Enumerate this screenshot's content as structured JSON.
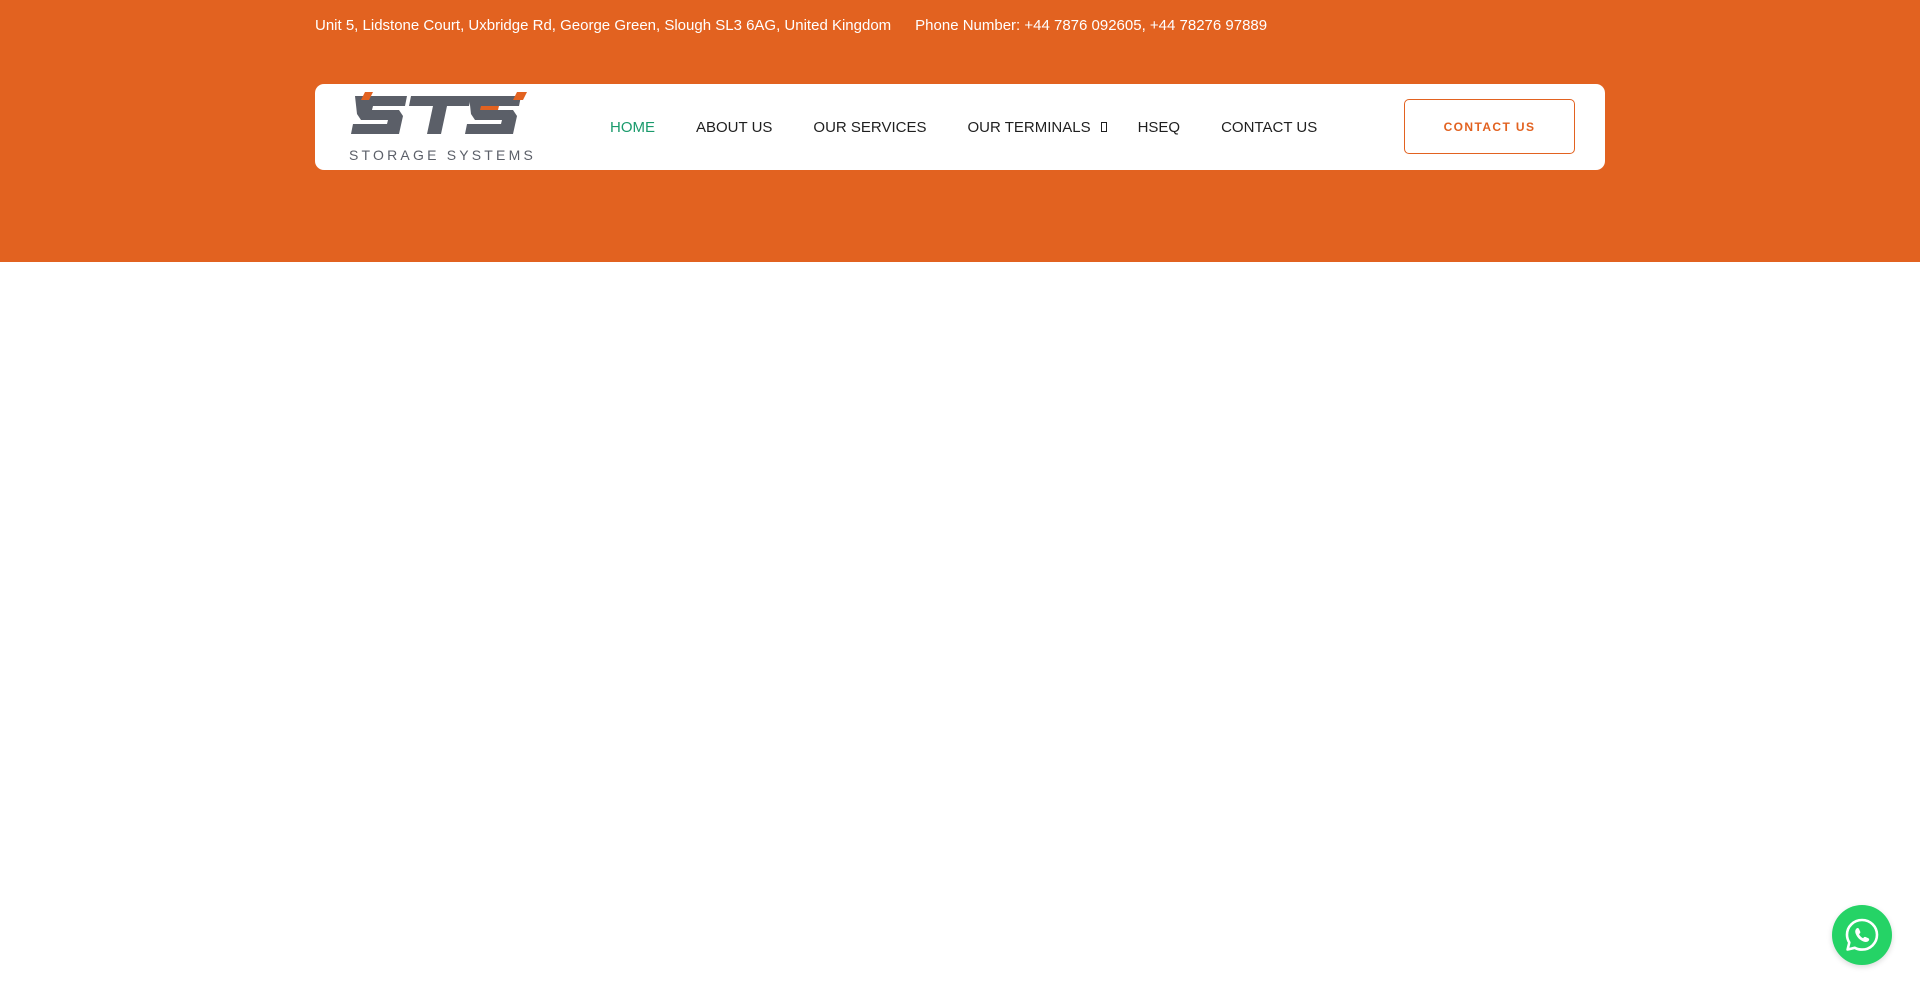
{
  "colors": {
    "brand_orange": "#e26220",
    "nav_active": "#1a9a6c",
    "logo_grey": "#5b5f68",
    "whatsapp_green": "#25d366"
  },
  "topbar": {
    "address": "Unit 5, Lidstone Court, Uxbridge Rd, George Green, Slough SL3 6AG, United Kingdom",
    "phone": "Phone Number: +44 7876 092605, +44 78276 97889"
  },
  "logo": {
    "mark": "STS",
    "tagline": "STORAGE SYSTEMS"
  },
  "nav": {
    "items": [
      {
        "label": "HOME",
        "active": true
      },
      {
        "label": "ABOUT US"
      },
      {
        "label": "OUR SERVICES"
      },
      {
        "label": "OUR TERMINALS",
        "dropdown_icon": "chevron-down-icon"
      },
      {
        "label": "HSEQ"
      },
      {
        "label": "CONTACT US"
      }
    ]
  },
  "cta": {
    "label": "CONTACT US"
  },
  "floating": {
    "icon": "whatsapp-icon"
  }
}
